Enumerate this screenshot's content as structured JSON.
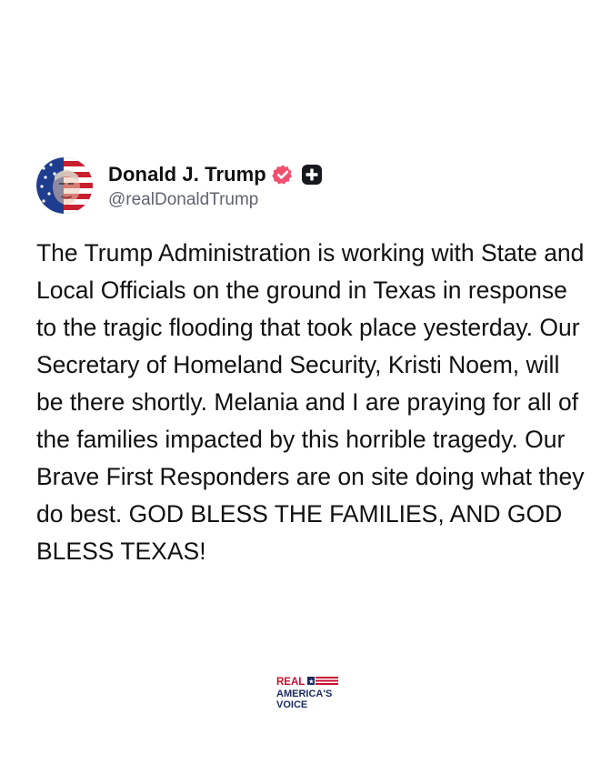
{
  "post": {
    "author": {
      "display_name": "Donald J. Trump",
      "handle": "@realDonaldTrump",
      "verified_icon": "verified-badge-icon",
      "subscription_icon": "plus-badge-icon",
      "avatar_icon": "avatar"
    },
    "text": "The Trump Administration is working with State and Local Officials on the ground in Texas in response to the tragic flooding that took place yesterday. Our Secretary of Homeland Security, Kristi Noem, will be there shortly. Melania and I are praying for all of the families impacted by this horrible tragedy. Our Brave First Responders are on site doing what they do best. GOD BLESS THE FAMILIES, AND GOD BLESS TEXAS!"
  },
  "watermark": {
    "line1": "REAL",
    "line2": "AMERICA'S",
    "line3": "VOICE",
    "brand_red": "#c8102e",
    "brand_navy": "#1a2a5e"
  },
  "colors": {
    "verified": "#f0506e",
    "handle": "#5f6470",
    "text": "#111111"
  }
}
